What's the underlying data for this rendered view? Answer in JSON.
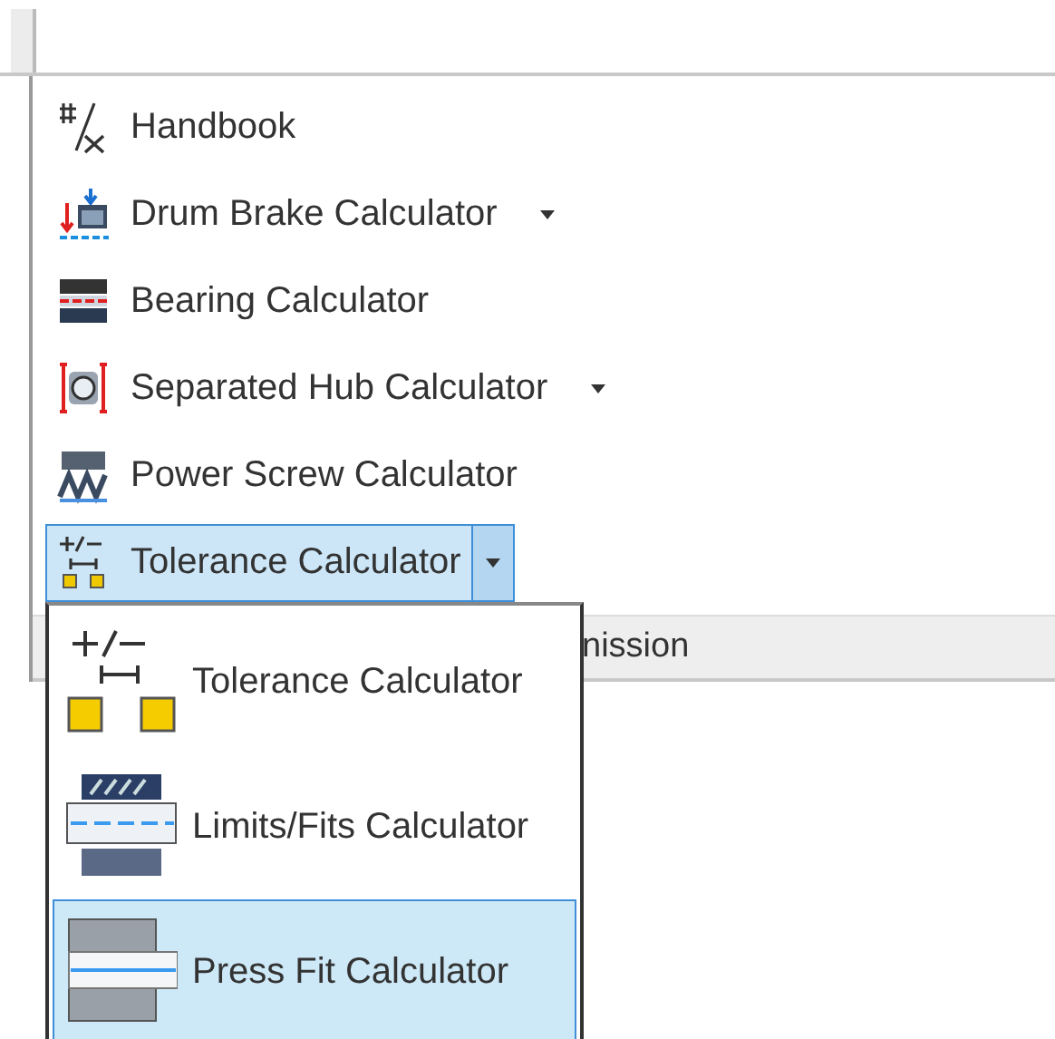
{
  "panel_items": [
    {
      "label": "Handbook",
      "kind": "button",
      "selected": false
    },
    {
      "label": "Drum Brake Calculator",
      "kind": "dropdown",
      "selected": false
    },
    {
      "label": "Bearing Calculator",
      "kind": "button",
      "selected": false
    },
    {
      "label": "Separated Hub Calculator",
      "kind": "dropdown",
      "selected": false
    },
    {
      "label": "Power Screw Calculator",
      "kind": "button",
      "selected": false
    },
    {
      "label": "Tolerance Calculator",
      "kind": "split",
      "selected": true
    }
  ],
  "background_bar": {
    "text": "nission"
  },
  "flyout_menu": [
    {
      "label": "Tolerance Calculator",
      "selected": false
    },
    {
      "label": "Limits/Fits Calculator",
      "selected": false
    },
    {
      "label": "Press Fit Calculator",
      "selected": true
    }
  ]
}
